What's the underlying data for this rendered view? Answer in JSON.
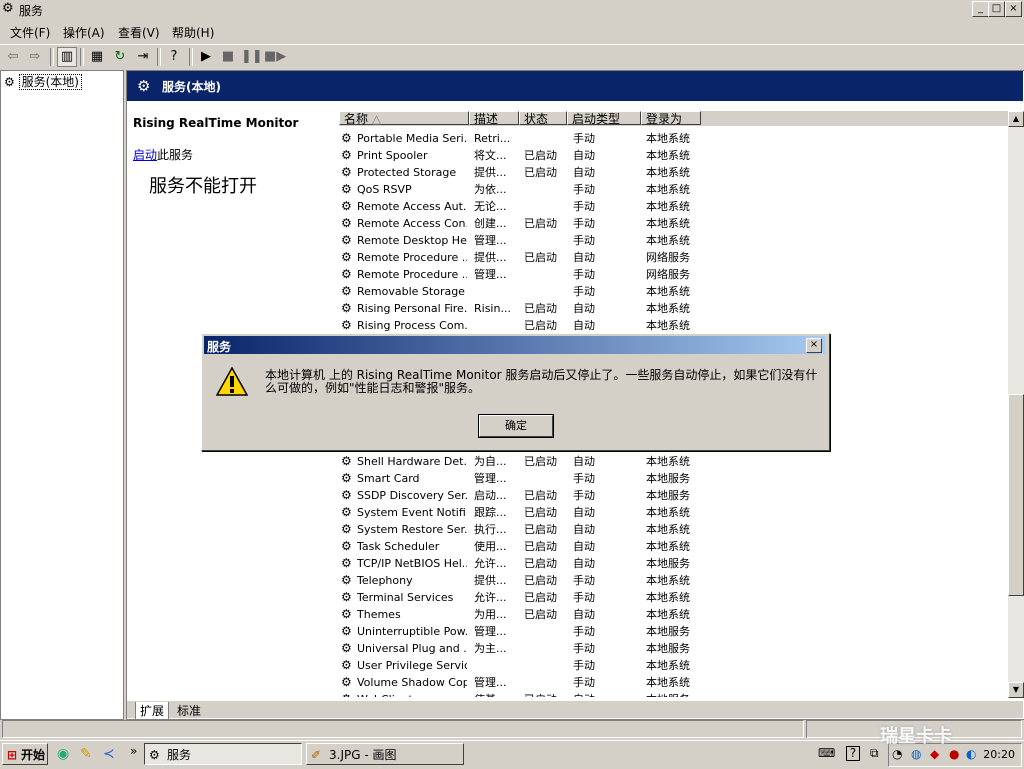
{
  "window": {
    "title": "服务",
    "min": "_",
    "max": "□",
    "close": "×"
  },
  "menu": [
    "文件(F)",
    "操作(A)",
    "查看(V)",
    "帮助(H)"
  ],
  "tree": {
    "root": "服务(本地)"
  },
  "panel": {
    "title": "服务(本地)",
    "service_name": "Rising RealTime Monitor",
    "start_link": "启动",
    "start_suffix": "此服务",
    "big_message": "服务不能打开"
  },
  "columns": [
    "名称",
    "描述",
    "状态",
    "启动类型",
    "登录为"
  ],
  "rows_top": [
    [
      "Portable Media Seri...",
      "Retri...",
      "",
      "手动",
      "本地系统"
    ],
    [
      "Print Spooler",
      "将文...",
      "已启动",
      "自动",
      "本地系统"
    ],
    [
      "Protected Storage",
      "提供...",
      "已启动",
      "自动",
      "本地系统"
    ],
    [
      "QoS RSVP",
      "为依...",
      "",
      "手动",
      "本地系统"
    ],
    [
      "Remote Access Aut...",
      "无论...",
      "",
      "手动",
      "本地系统"
    ],
    [
      "Remote Access Con...",
      "创建...",
      "已启动",
      "手动",
      "本地系统"
    ],
    [
      "Remote Desktop He...",
      "管理...",
      "",
      "手动",
      "本地系统"
    ],
    [
      "Remote Procedure ...",
      "提供...",
      "已启动",
      "自动",
      "网络服务"
    ],
    [
      "Remote Procedure ...",
      "管理...",
      "",
      "手动",
      "网络服务"
    ],
    [
      "Removable Storage",
      "",
      "",
      "手动",
      "本地系统"
    ],
    [
      "Rising Personal Fire...",
      "Risin...",
      "已启动",
      "自动",
      "本地系统"
    ],
    [
      "Rising Process Com...",
      "",
      "已启动",
      "自动",
      "本地系统"
    ]
  ],
  "rows_bottom": [
    [
      "Shell Hardware Det...",
      "为自...",
      "已启动",
      "自动",
      "本地系统"
    ],
    [
      "Smart Card",
      "管理...",
      "",
      "手动",
      "本地服务"
    ],
    [
      "SSDP Discovery Ser...",
      "启动...",
      "已启动",
      "手动",
      "本地服务"
    ],
    [
      "System Event Notifi...",
      "跟踪...",
      "已启动",
      "自动",
      "本地系统"
    ],
    [
      "System Restore Ser...",
      "执行...",
      "已启动",
      "自动",
      "本地系统"
    ],
    [
      "Task Scheduler",
      "使用...",
      "已启动",
      "自动",
      "本地系统"
    ],
    [
      "TCP/IP NetBIOS Hel...",
      "允许...",
      "已启动",
      "自动",
      "本地服务"
    ],
    [
      "Telephony",
      "提供...",
      "已启动",
      "手动",
      "本地系统"
    ],
    [
      "Terminal Services",
      "允许...",
      "已启动",
      "手动",
      "本地系统"
    ],
    [
      "Themes",
      "为用...",
      "已启动",
      "自动",
      "本地系统"
    ],
    [
      "Uninterruptible Pow...",
      "管理...",
      "",
      "手动",
      "本地服务"
    ],
    [
      "Universal Plug and ...",
      "为主...",
      "",
      "手动",
      "本地服务"
    ],
    [
      "User Privilege Service",
      "",
      "",
      "手动",
      "本地系统"
    ],
    [
      "Volume Shadow Copy",
      "管理...",
      "",
      "手动",
      "本地系统"
    ],
    [
      "WebClient",
      "使基...",
      "已启动",
      "自动",
      "本地服务"
    ]
  ],
  "tabs": [
    "扩展",
    "标准"
  ],
  "dialog": {
    "title": "服务",
    "message": "本地计算机 上的 Rising RealTime Monitor 服务启动后又停止了。一些服务自动停止，如果它们没有什么可做的，例如\"性能日志和警报\"服务。",
    "ok": "确定",
    "close": "×"
  },
  "taskbar": {
    "start": "开始",
    "tasks": [
      "服务",
      "3.JPG - 画图"
    ],
    "clock": "20:20",
    "more": "»"
  },
  "watermark": "瑞星卡卡"
}
